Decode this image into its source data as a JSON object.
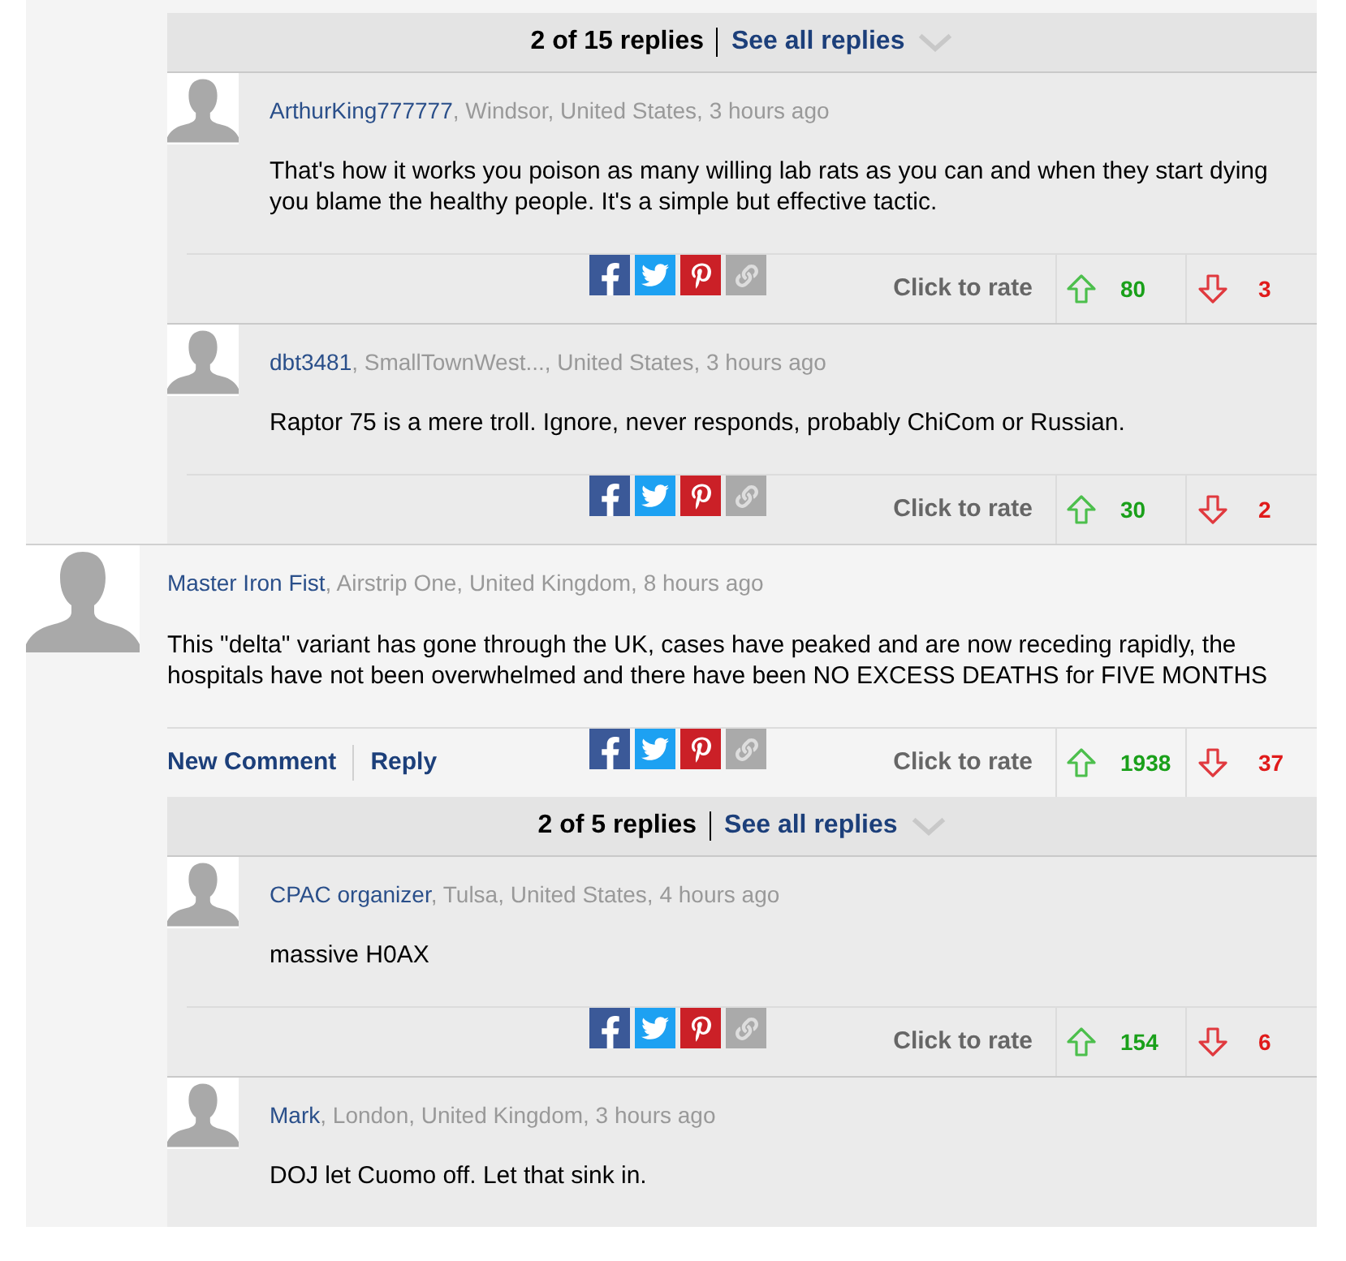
{
  "threads": [
    {
      "replies_summary": {
        "count": "2 of 15 replies",
        "link": "See all replies"
      },
      "replies": [
        {
          "author": "ArthurKing777777",
          "meta": ", Windsor, United States, 3 hours ago",
          "body": "That's how it works you poison as many willing lab rats as you can and when they start dying you blame the healthy people. It's a simple but effective tactic.",
          "rate_label": "Click to rate",
          "up": "80",
          "down": "3"
        },
        {
          "author": "dbt3481",
          "meta": ", SmallTownWest..., United States, 3 hours ago",
          "body": "Raptor 75 is a mere troll. Ignore, never responds, probably ChiCom or Russian.",
          "rate_label": "Click to rate",
          "up": "30",
          "down": "2"
        }
      ]
    },
    {
      "author": "Master Iron Fist",
      "meta": ", Airstrip One, United Kingdom, 8 hours ago",
      "body": "This \"delta\" variant has gone through the UK, cases have peaked and are now receding rapidly, the hospitals have not been overwhelmed and there have been NO EXCESS DEATHS for FIVE MONTHS",
      "links": [
        "New Comment",
        "Reply"
      ],
      "rate_label": "Click to rate",
      "up": "1938",
      "down": "37",
      "replies_summary": {
        "count": "2 of 5 replies",
        "link": "See all replies"
      },
      "replies": [
        {
          "author": "CPAC organizer",
          "meta": ", Tulsa, United States, 4 hours ago",
          "body": "massive H0AX",
          "rate_label": "Click to rate",
          "up": "154",
          "down": "6"
        },
        {
          "author": "Mark",
          "meta": ", London, United Kingdom, 3 hours ago",
          "body": "DOJ let Cuomo off. Let that sink in."
        }
      ]
    }
  ]
}
